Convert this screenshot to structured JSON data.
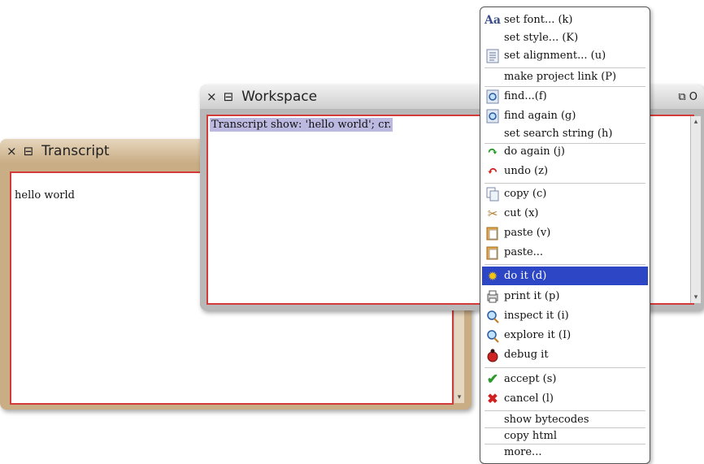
{
  "transcript_window": {
    "title": "Transcript",
    "close_glyph": "×",
    "menu_glyph": "⊟",
    "text": "hello world"
  },
  "workspace_window": {
    "title": "Workspace",
    "close_glyph": "×",
    "menu_glyph": "⊟",
    "right_glyphs": "⧉ O",
    "code": "Transcript show: 'hello world'; cr."
  },
  "context_menu": {
    "items": [
      {
        "label": "set font... (k)",
        "icon": "Aa"
      },
      {
        "label": "set style... (K)",
        "icon": ""
      },
      {
        "label": "set alignment... (u)",
        "icon": "alignment-icon"
      },
      {
        "label": "make project link (P)",
        "icon": ""
      },
      {
        "label": "find...(f)",
        "icon": "find-icon"
      },
      {
        "label": "find again (g)",
        "icon": "find-again-icon"
      },
      {
        "label": "set search string (h)",
        "icon": ""
      },
      {
        "label": "do again (j)",
        "icon": "redo-icon"
      },
      {
        "label": "undo (z)",
        "icon": "undo-icon"
      },
      {
        "label": "copy (c)",
        "icon": "copy-icon"
      },
      {
        "label": "cut (x)",
        "icon": "scissors-icon"
      },
      {
        "label": "paste (v)",
        "icon": "paste-icon"
      },
      {
        "label": "paste...",
        "icon": "paste-icon"
      },
      {
        "label": "do it (d)",
        "icon": "gear-icon",
        "selected": true
      },
      {
        "label": "print it (p)",
        "icon": "print-it-icon"
      },
      {
        "label": "inspect it (i)",
        "icon": "inspect-icon"
      },
      {
        "label": "explore it (I)",
        "icon": "explore-icon"
      },
      {
        "label": "debug it",
        "icon": "bug-icon"
      },
      {
        "label": "accept (s)",
        "icon": "checkmark-icon"
      },
      {
        "label": "cancel (l)",
        "icon": "cross-icon"
      },
      {
        "label": "show bytecodes",
        "icon": ""
      },
      {
        "label": "copy html",
        "icon": ""
      },
      {
        "label": "more...",
        "icon": ""
      }
    ]
  },
  "colors": {
    "selection_blue": "#2c46c6",
    "pane_border_red": "#d33b3b",
    "transcript_frame": "#c9ad85",
    "text_selection": "#bcb9e0"
  }
}
